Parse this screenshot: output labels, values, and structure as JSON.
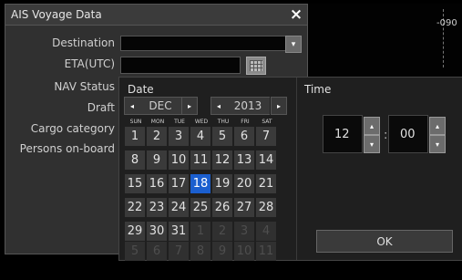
{
  "window": {
    "title": "AIS Voyage Data",
    "close_icon": "×"
  },
  "fields": {
    "destination": "Destination",
    "eta": "ETA(UTC)",
    "nav_status": "NAV Status",
    "draft": "Draft",
    "cargo": "Cargo category",
    "persons": "Persons on-board",
    "destination_value": "",
    "eta_value": "",
    "dropdown_icon": "▾"
  },
  "background": {
    "bearing_label": "-090"
  },
  "picker": {
    "date_heading": "Date",
    "time_heading": "Time",
    "prev_icon": "◂",
    "next_icon": "▸",
    "month": "DEC",
    "year": "2013",
    "weekdays": [
      "SUN",
      "MON",
      "TUE",
      "WED",
      "THU",
      "FRI",
      "SAT"
    ],
    "days": [
      [
        "1",
        "2",
        "3",
        "4",
        "5",
        "6",
        "7"
      ],
      [
        "8",
        "9",
        "10",
        "11",
        "12",
        "13",
        "14"
      ],
      [
        "15",
        "16",
        "17",
        "18",
        "19",
        "20",
        "21"
      ],
      [
        "22",
        "23",
        "24",
        "25",
        "26",
        "27",
        "28"
      ],
      [
        "29",
        "30",
        "31",
        "1",
        "2",
        "3",
        "4"
      ],
      [
        "5",
        "6",
        "7",
        "8",
        "9",
        "10",
        "11"
      ]
    ],
    "selected_day": "18",
    "hour": "12",
    "minute": "00",
    "colon": ":",
    "up_icon": "▴",
    "down_icon": "▾",
    "ok_label": "OK"
  }
}
